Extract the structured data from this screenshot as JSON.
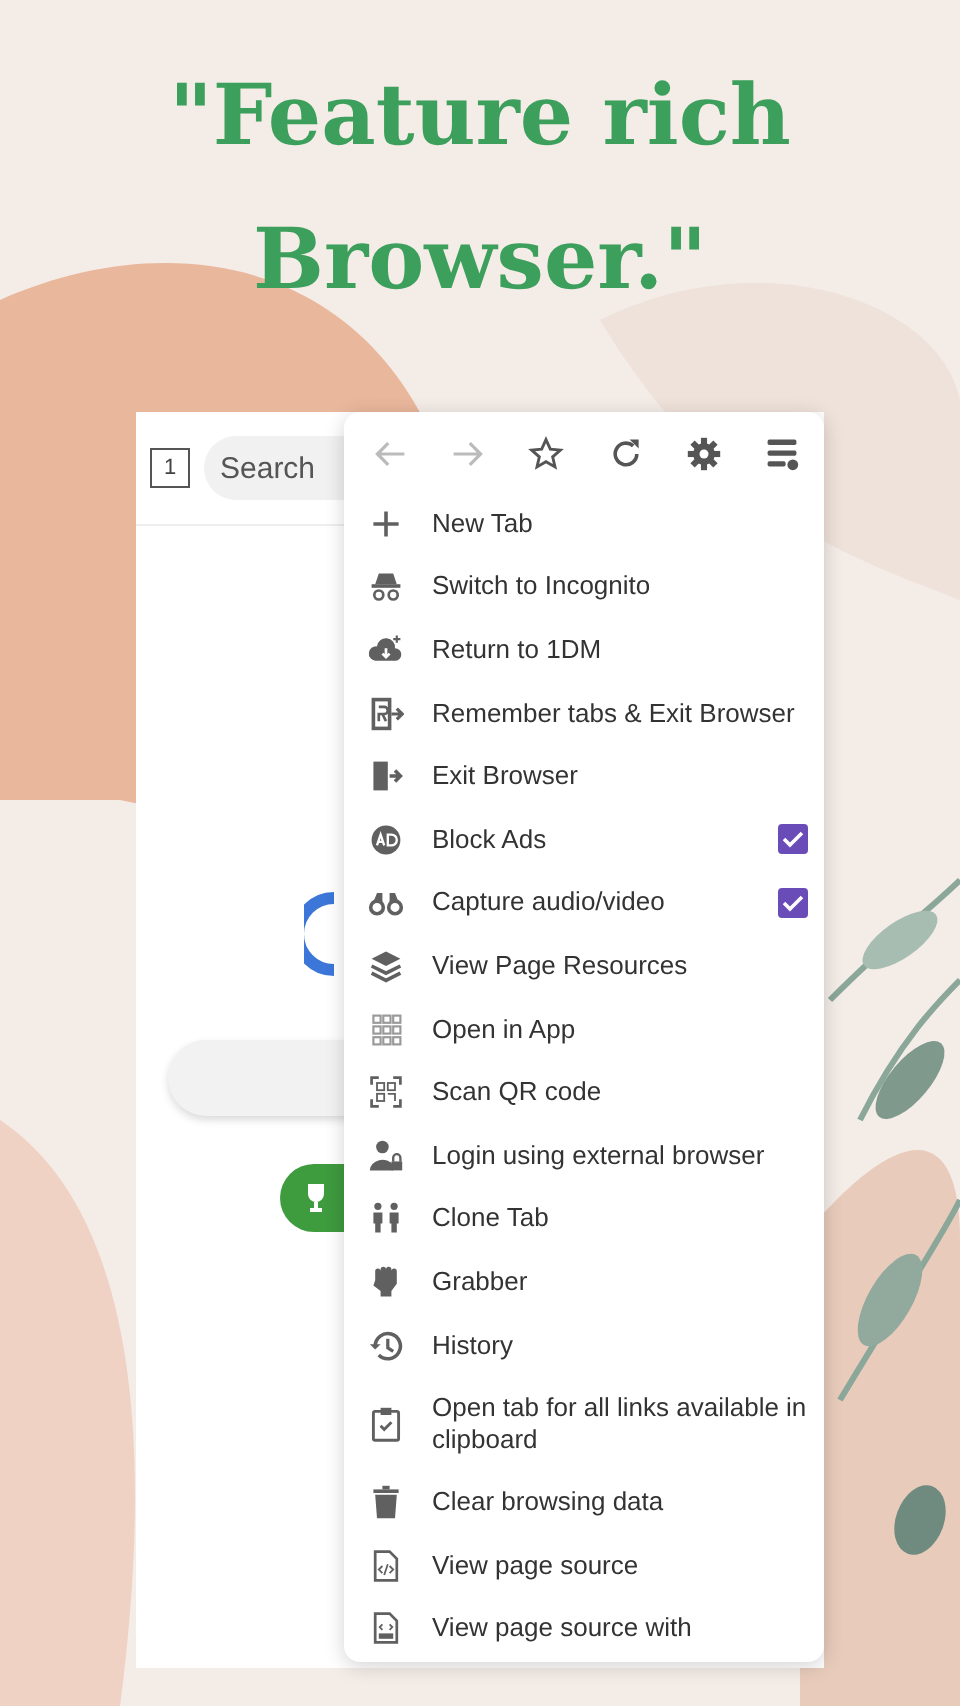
{
  "headline": "\"Feature rich Browser.\"",
  "browser": {
    "tab_count": "1",
    "search": {
      "placeholder": "Search"
    }
  },
  "menu": {
    "toolbar": [
      {
        "kind": "back",
        "disabled": true
      },
      {
        "kind": "forward",
        "disabled": true
      },
      {
        "kind": "bookmark",
        "disabled": false
      },
      {
        "kind": "reload",
        "disabled": false
      },
      {
        "kind": "settings",
        "disabled": false
      },
      {
        "kind": "options",
        "disabled": false
      }
    ],
    "items": [
      {
        "kind": "action",
        "label": "New Tab"
      },
      {
        "kind": "action",
        "label": "Switch to Incognito"
      },
      {
        "kind": "action",
        "label": "Return to 1DM"
      },
      {
        "kind": "action",
        "label": "Remember tabs & Exit Browser"
      },
      {
        "kind": "action",
        "label": "Exit Browser"
      },
      {
        "kind": "toggle",
        "label": "Block Ads",
        "checked": true
      },
      {
        "kind": "toggle",
        "label": "Capture audio/video",
        "checked": true
      },
      {
        "kind": "action",
        "label": "View Page Resources"
      },
      {
        "kind": "action",
        "label": "Open in App"
      },
      {
        "kind": "action",
        "label": "Scan QR code"
      },
      {
        "kind": "action",
        "label": "Login using external browser"
      },
      {
        "kind": "action",
        "label": "Clone Tab"
      },
      {
        "kind": "action",
        "label": "Grabber"
      },
      {
        "kind": "action",
        "label": "History"
      },
      {
        "kind": "action",
        "label": "Open tab for all links available in clipboard"
      },
      {
        "kind": "action",
        "label": "Clear browsing data"
      },
      {
        "kind": "action",
        "label": "View page source"
      },
      {
        "kind": "action",
        "label": "View page source with"
      }
    ]
  }
}
